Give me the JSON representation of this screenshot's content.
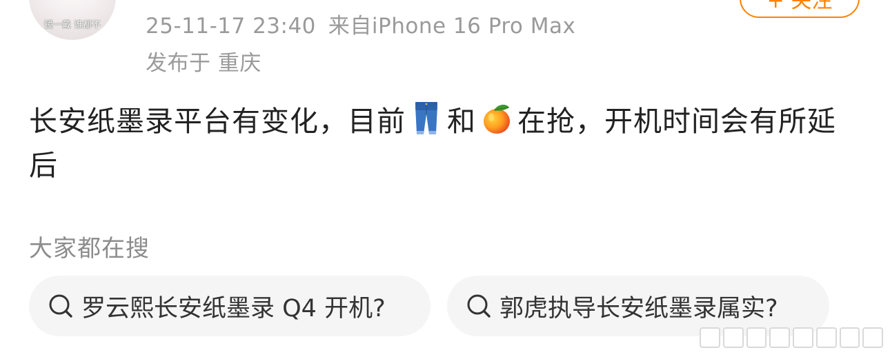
{
  "user": {
    "avatar_caption": "镜一戴 谁都不"
  },
  "follow_button": {
    "label": "+ 关注"
  },
  "post": {
    "timestamp": "25-11-17 23:40",
    "source": "来自iPhone 16 Pro Max",
    "location": "发布于 重庆",
    "text_part1": "长安纸墨录平台有变化，目前",
    "emoji_1": "jeans-emoji",
    "text_part2": "和",
    "emoji_2": "mango-emoji",
    "text_part3": "在抢，开机时间会有所延后"
  },
  "related_search": {
    "label": "大家都在搜",
    "items": [
      {
        "icon": "search-icon",
        "text": "罗云熙长安纸墨录 Q4 开机?"
      },
      {
        "icon": "search-icon",
        "text": "郭虎执导长安纸墨录属实?"
      }
    ]
  },
  "colors": {
    "accent": "#ff8200",
    "meta_text": "#9a9a9a",
    "body_text": "#222222",
    "chip_bg": "#f5f5f5"
  }
}
